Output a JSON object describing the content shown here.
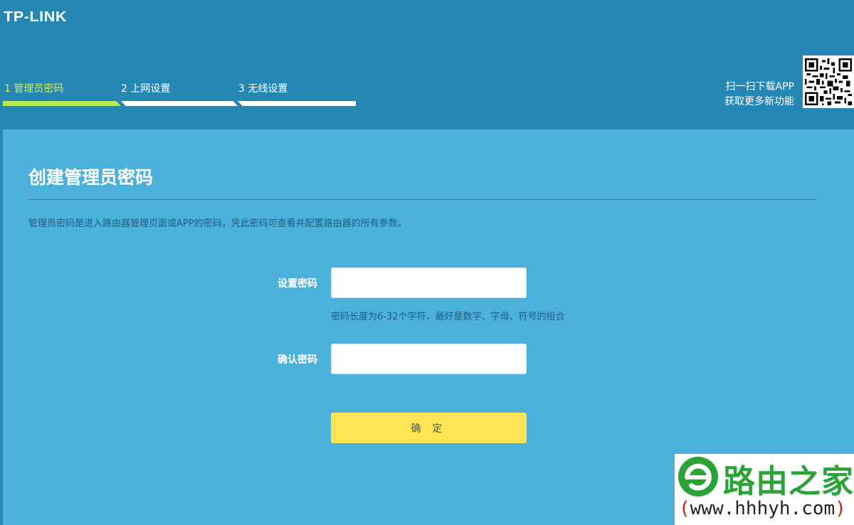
{
  "header": {
    "logo": "TP-LINK",
    "steps": [
      {
        "label": "1 管理员密码",
        "active": true
      },
      {
        "label": "2 上网设置",
        "active": false
      },
      {
        "label": "3 无线设置",
        "active": false
      }
    ],
    "app_promo": {
      "line1": "扫一扫下载APP",
      "line2": "获取更多新功能"
    }
  },
  "panel": {
    "title": "创建管理员密码",
    "description": "管理员密码是进入路由器管理页面或APP的密码，凭此密码可查看并配置路由器的所有参数。",
    "fields": {
      "set_password": {
        "label": "设置密码",
        "value": ""
      },
      "confirm_password": {
        "label": "确认密码",
        "value": ""
      }
    },
    "hint": "密码长度为6-32个字符，最好是数字、字母、符号的组合",
    "confirm_button": "确 定"
  },
  "watermark": {
    "brand": "路由之家",
    "url_open": "(",
    "url": "www.hhhyh.com",
    "url_close": ")"
  },
  "colors": {
    "header_bg": "#2587b4",
    "panel_bg": "#4bb1da",
    "active_step": "#b3ec58",
    "button_bg": "#fde553",
    "watermark_green": "#2ca339",
    "watermark_red": "#d71b1b"
  },
  "icons": {
    "qr": "qr-code-icon",
    "watermark_logo": "router-home-logo-icon"
  }
}
